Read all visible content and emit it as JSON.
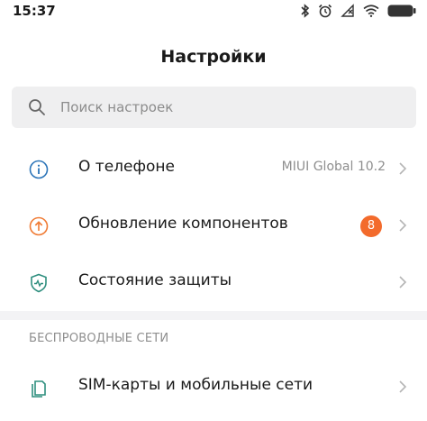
{
  "status_bar": {
    "time": "15:37",
    "icons": [
      "bluetooth-icon",
      "alarm-icon",
      "signal-off-icon",
      "wifi-icon",
      "battery-icon"
    ]
  },
  "header": {
    "title": "Настройки"
  },
  "search": {
    "placeholder": "Поиск настроек",
    "value": ""
  },
  "items": [
    {
      "label": "О телефоне",
      "value": "MIUI Global 10.2",
      "icon": "info-icon"
    },
    {
      "label": "Обновление компонентов",
      "badge": "8",
      "icon": "update-icon"
    },
    {
      "label": "Состояние защиты",
      "icon": "shield-icon"
    }
  ],
  "section": {
    "title": "БЕСПРОВОДНЫЕ СЕТИ"
  },
  "network_items": [
    {
      "label": "SIM-карты и мобильные сети",
      "icon": "sim-icon"
    }
  ],
  "colors": {
    "badge": "#f36b2c",
    "icon_blue": "#2b74b8",
    "icon_orange": "#f07b34",
    "icon_teal": "#2f8f7f"
  }
}
